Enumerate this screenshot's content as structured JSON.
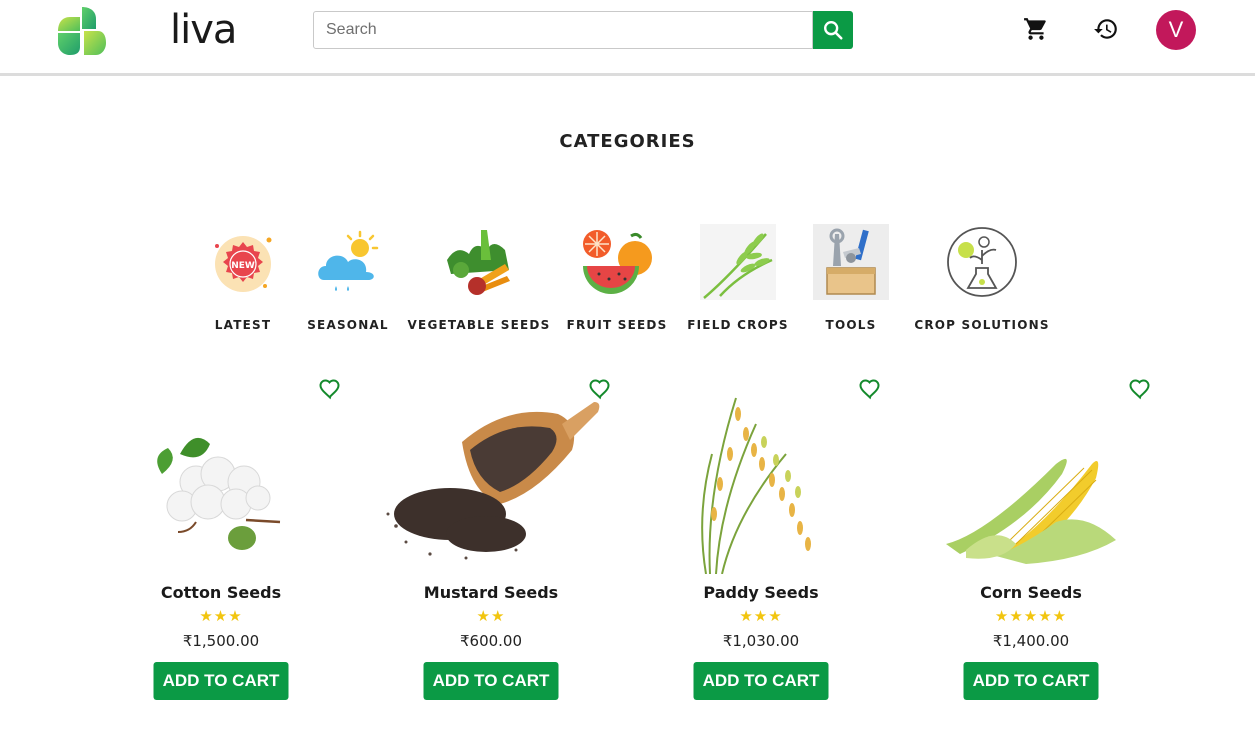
{
  "header": {
    "logo_text": "liva",
    "search": {
      "placeholder": "Search",
      "value": ""
    },
    "icons": [
      "cart-icon",
      "history-icon",
      "search-icon"
    ],
    "avatar_initial": "V"
  },
  "categories_section": {
    "title": "CATEGORIES",
    "items": [
      {
        "label": "LATEST",
        "icon": "new-badge-icon"
      },
      {
        "label": "SEASONAL",
        "icon": "weather-icon"
      },
      {
        "label": "VEGETABLE SEEDS",
        "icon": "vegetables-icon"
      },
      {
        "label": "FRUIT SEEDS",
        "icon": "fruits-icon"
      },
      {
        "label": "FIELD CROPS",
        "icon": "wheat-icon"
      },
      {
        "label": "TOOLS",
        "icon": "toolbox-icon"
      },
      {
        "label": "CROP SOLUTIONS",
        "icon": "plant-flask-icon"
      }
    ]
  },
  "products": [
    {
      "name": "Cotton Seeds",
      "stars": "★★★",
      "rating": 3,
      "price": "₹1,500.00",
      "button": "ADD TO CART"
    },
    {
      "name": "Mustard Seeds",
      "stars": "★★",
      "rating": 2,
      "price": "₹600.00",
      "button": "ADD TO CART"
    },
    {
      "name": "Paddy Seeds",
      "stars": "★★★",
      "rating": 3,
      "price": "₹1,030.00",
      "button": "ADD TO CART"
    },
    {
      "name": "Corn Seeds",
      "stars": "★★★★★",
      "rating": 5,
      "price": "₹1,400.00",
      "button": "ADD TO CART"
    }
  ],
  "colors": {
    "primary_green": "#0b9a45",
    "avatar": "#c2185b",
    "star": "#f2c50f",
    "heart": "#148a2c"
  }
}
